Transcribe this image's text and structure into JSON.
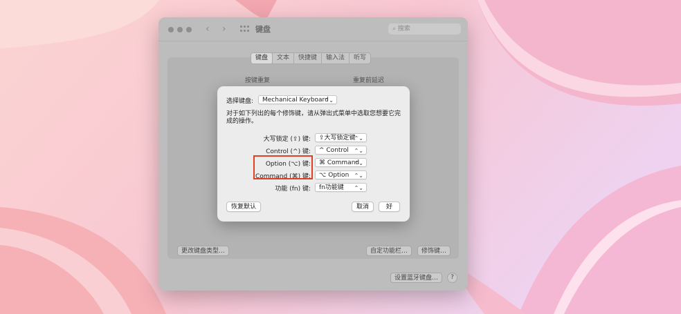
{
  "window": {
    "title": "键盘",
    "search_placeholder": "搜索",
    "nav_back": "‹",
    "nav_forward": "›",
    "tabs": [
      {
        "label": "键盘",
        "active": true
      },
      {
        "label": "文本",
        "active": false
      },
      {
        "label": "快捷键",
        "active": false
      },
      {
        "label": "输入法",
        "active": false
      },
      {
        "label": "听写",
        "active": false
      }
    ],
    "panel_labels": [
      "按键重复",
      "重复前延迟"
    ],
    "buttons": {
      "change_type": "更改键盘类型…",
      "customize_control_strip": "自定功能栏…",
      "modifier_keys": "修饰键…",
      "setup_bluetooth": "设置蓝牙键盘…",
      "help": "?"
    }
  },
  "sheet": {
    "select_label": "选择键盘:",
    "keyboard_value": "Mechanical Keyboard",
    "description": "对于如下列出的每个修饰键，请从弹出式菜单中选取您想要它完成的操作。",
    "rows": [
      {
        "label": "大写锁定 (⇪) 键:",
        "value": "⇪大写锁定键"
      },
      {
        "label": "Control (^) 键:",
        "value": "^ Control"
      },
      {
        "label": "Option (⌥) 键:",
        "value": "⌘ Command"
      },
      {
        "label": "Command (⌘) 键:",
        "value": "⌥ Option"
      },
      {
        "label": "功能 (fn) 键:",
        "value": "fn功能键"
      }
    ],
    "restore_defaults": "恢复默认",
    "cancel": "取消",
    "ok": "好"
  },
  "colors": {
    "highlight": "#e0401f",
    "window_dimmed": "#bdbdbd",
    "sheet_bg": "#ececec"
  }
}
